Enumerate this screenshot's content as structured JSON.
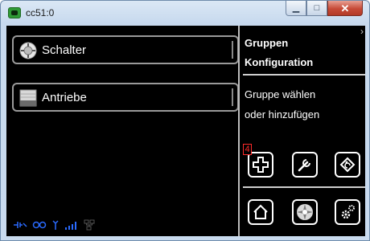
{
  "window": {
    "title": "cc51:0",
    "minimize_glyph": "▁",
    "maximize_glyph": "□",
    "close_glyph": "✕"
  },
  "menu": {
    "items": [
      {
        "label": "Schalter",
        "icon": "switch-dial-icon"
      },
      {
        "label": "Antriebe",
        "icon": "blind-drive-icon"
      }
    ]
  },
  "panel": {
    "title_line1": "Gruppen",
    "title_line2": "Konfiguration",
    "hint_line1": "Gruppe wählen",
    "hint_line2": "oder hinzufügen",
    "badge": "4"
  },
  "toolbar_icons": [
    "add-group-icon",
    "wrench-icon",
    "back-icon",
    "home-icon",
    "light-bulb-icon",
    "settings-gears-icon"
  ],
  "status_icons": [
    "connection-plug-icon",
    "link-icon",
    "antenna-icon",
    "signal-bars-icon",
    "network-icon"
  ],
  "colors": {
    "background": "#000000",
    "text": "#ffffff",
    "badge": "#ff2a2a",
    "status": "#2a6bff"
  }
}
